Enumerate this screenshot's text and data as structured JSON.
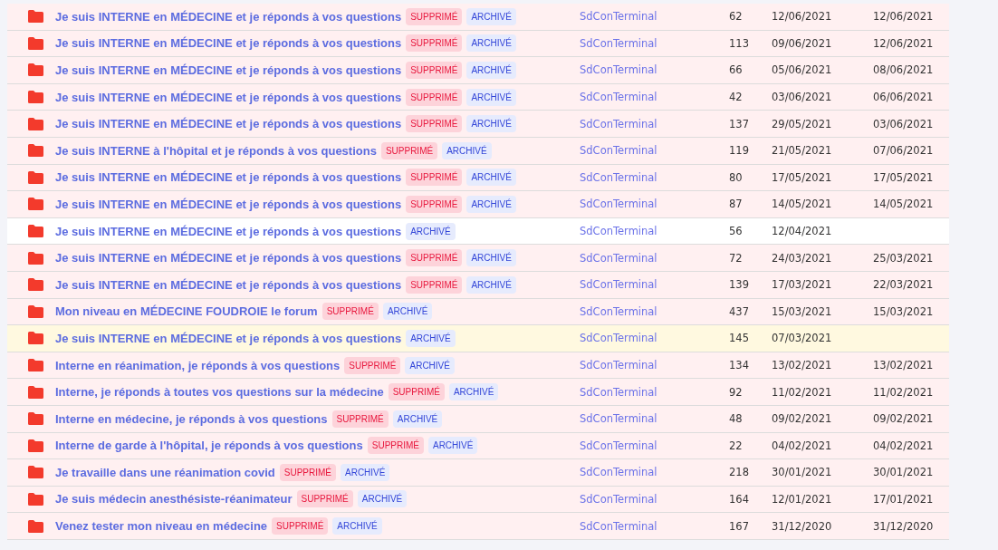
{
  "rows": [
    {
      "title": "Je suis INTERNE en MÉDECINE et je réponds à vos questions",
      "deleted": true,
      "hovered": false,
      "badges": [
        {
          "kind": "deleted",
          "label": "SUPPRIMÉ"
        },
        {
          "kind": "archived",
          "label": "ARCHIVÉ"
        }
      ],
      "author": "SdConTerminal",
      "count": "62",
      "created": "12/06/2021",
      "last": "12/06/2021"
    },
    {
      "title": "Je suis INTERNE en MÉDECINE et je réponds à vos questions",
      "deleted": true,
      "hovered": false,
      "badges": [
        {
          "kind": "deleted",
          "label": "SUPPRIMÉ"
        },
        {
          "kind": "archived",
          "label": "ARCHIVÉ"
        }
      ],
      "author": "SdConTerminal",
      "count": "113",
      "created": "09/06/2021",
      "last": "12/06/2021"
    },
    {
      "title": "Je suis INTERNE en MÉDECINE et je réponds à vos questions",
      "deleted": true,
      "hovered": false,
      "badges": [
        {
          "kind": "deleted",
          "label": "SUPPRIMÉ"
        },
        {
          "kind": "archived",
          "label": "ARCHIVÉ"
        }
      ],
      "author": "SdConTerminal",
      "count": "66",
      "created": "05/06/2021",
      "last": "08/06/2021"
    },
    {
      "title": "Je suis INTERNE en MÉDECINE et je réponds à vos questions",
      "deleted": true,
      "hovered": false,
      "badges": [
        {
          "kind": "deleted",
          "label": "SUPPRIMÉ"
        },
        {
          "kind": "archived",
          "label": "ARCHIVÉ"
        }
      ],
      "author": "SdConTerminal",
      "count": "42",
      "created": "03/06/2021",
      "last": "06/06/2021"
    },
    {
      "title": "Je suis INTERNE en MÉDECINE et je réponds à vos questions",
      "deleted": true,
      "hovered": false,
      "badges": [
        {
          "kind": "deleted",
          "label": "SUPPRIMÉ"
        },
        {
          "kind": "archived",
          "label": "ARCHIVÉ"
        }
      ],
      "author": "SdConTerminal",
      "count": "137",
      "created": "29/05/2021",
      "last": "03/06/2021"
    },
    {
      "title": "Je suis INTERNE à l'hôpital et je réponds à vos questions",
      "deleted": true,
      "hovered": false,
      "badges": [
        {
          "kind": "deleted",
          "label": "SUPPRIMÉ"
        },
        {
          "kind": "archived",
          "label": "ARCHIVÉ"
        }
      ],
      "author": "SdConTerminal",
      "count": "119",
      "created": "21/05/2021",
      "last": "07/06/2021"
    },
    {
      "title": "Je suis INTERNE en MÉDECINE et je réponds à vos questions",
      "deleted": true,
      "hovered": false,
      "badges": [
        {
          "kind": "deleted",
          "label": "SUPPRIMÉ"
        },
        {
          "kind": "archived",
          "label": "ARCHIVÉ"
        }
      ],
      "author": "SdConTerminal",
      "count": "80",
      "created": "17/05/2021",
      "last": "17/05/2021"
    },
    {
      "title": "Je suis INTERNE en MÉDECINE et je réponds à vos questions",
      "deleted": true,
      "hovered": false,
      "badges": [
        {
          "kind": "deleted",
          "label": "SUPPRIMÉ"
        },
        {
          "kind": "archived",
          "label": "ARCHIVÉ"
        }
      ],
      "author": "SdConTerminal",
      "count": "87",
      "created": "14/05/2021",
      "last": "14/05/2021"
    },
    {
      "title": "Je suis INTERNE en MÉDECINE et je réponds à vos questions",
      "deleted": false,
      "hovered": false,
      "badges": [
        {
          "kind": "archived",
          "label": "ARCHIVÉ"
        }
      ],
      "author": "SdConTerminal",
      "count": "56",
      "created": "12/04/2021"
    },
    {
      "title": "Je suis INTERNE en MÉDECINE et je réponds à vos questions",
      "deleted": true,
      "hovered": false,
      "badges": [
        {
          "kind": "deleted",
          "label": "SUPPRIMÉ"
        },
        {
          "kind": "archived",
          "label": "ARCHIVÉ"
        }
      ],
      "author": "SdConTerminal",
      "count": "72",
      "created": "24/03/2021",
      "last": "25/03/2021"
    },
    {
      "title": "Je suis INTERNE en MÉDECINE et je réponds à vos questions",
      "deleted": true,
      "hovered": false,
      "badges": [
        {
          "kind": "deleted",
          "label": "SUPPRIMÉ"
        },
        {
          "kind": "archived",
          "label": "ARCHIVÉ"
        }
      ],
      "author": "SdConTerminal",
      "count": "139",
      "created": "17/03/2021",
      "last": "22/03/2021"
    },
    {
      "title": "Mon niveau en MÉDECINE FOUDROIE le forum",
      "deleted": true,
      "hovered": false,
      "badges": [
        {
          "kind": "deleted",
          "label": "SUPPRIMÉ"
        },
        {
          "kind": "archived",
          "label": "ARCHIVÉ"
        }
      ],
      "author": "SdConTerminal",
      "count": "437",
      "created": "15/03/2021",
      "last": "15/03/2021"
    },
    {
      "title": "Je suis INTERNE en MÉDECINE et je réponds à vos questions",
      "deleted": false,
      "hovered": true,
      "badges": [
        {
          "kind": "archived",
          "label": "ARCHIVÉ"
        }
      ],
      "author": "SdConTerminal",
      "count": "145",
      "created": "07/03/2021"
    },
    {
      "title": "Interne en réanimation, je réponds à vos questions",
      "deleted": true,
      "hovered": false,
      "badges": [
        {
          "kind": "deleted",
          "label": "SUPPRIMÉ"
        },
        {
          "kind": "archived",
          "label": "ARCHIVÉ"
        }
      ],
      "author": "SdConTerminal",
      "count": "134",
      "created": "13/02/2021",
      "last": "13/02/2021"
    },
    {
      "title": "Interne, je réponds à toutes vos questions sur la médecine",
      "deleted": true,
      "hovered": false,
      "badges": [
        {
          "kind": "deleted",
          "label": "SUPPRIMÉ"
        },
        {
          "kind": "archived",
          "label": "ARCHIVÉ"
        }
      ],
      "author": "SdConTerminal",
      "count": "92",
      "created": "11/02/2021",
      "last": "11/02/2021"
    },
    {
      "title": "Interne en médecine, je réponds à vos questions",
      "deleted": true,
      "hovered": false,
      "badges": [
        {
          "kind": "deleted",
          "label": "SUPPRIMÉ"
        },
        {
          "kind": "archived",
          "label": "ARCHIVÉ"
        }
      ],
      "author": "SdConTerminal",
      "count": "48",
      "created": "09/02/2021",
      "last": "09/02/2021"
    },
    {
      "title": "Interne de garde à l'hôpital, je réponds à vos questions",
      "deleted": true,
      "hovered": false,
      "badges": [
        {
          "kind": "deleted",
          "label": "SUPPRIMÉ"
        },
        {
          "kind": "archived",
          "label": "ARCHIVÉ"
        }
      ],
      "author": "SdConTerminal",
      "count": "22",
      "created": "04/02/2021",
      "last": "04/02/2021"
    },
    {
      "title": "Je travaille dans une réanimation covid",
      "deleted": true,
      "hovered": false,
      "badges": [
        {
          "kind": "deleted",
          "label": "SUPPRIMÉ"
        },
        {
          "kind": "archived",
          "label": "ARCHIVÉ"
        }
      ],
      "author": "SdConTerminal",
      "count": "218",
      "created": "30/01/2021",
      "last": "30/01/2021"
    },
    {
      "title": "Je suis médecin anesthésiste-réanimateur",
      "deleted": true,
      "hovered": false,
      "badges": [
        {
          "kind": "deleted",
          "label": "SUPPRIMÉ"
        },
        {
          "kind": "archived",
          "label": "ARCHIVÉ"
        }
      ],
      "author": "SdConTerminal",
      "count": "164",
      "created": "12/01/2021",
      "last": "17/01/2021"
    },
    {
      "title": "Venez tester mon niveau en médecine",
      "deleted": true,
      "hovered": false,
      "badges": [
        {
          "kind": "deleted",
          "label": "SUPPRIMÉ"
        },
        {
          "kind": "archived",
          "label": "ARCHIVÉ"
        }
      ],
      "author": "SdConTerminal",
      "count": "167",
      "created": "31/12/2020",
      "last": "31/12/2020"
    }
  ]
}
